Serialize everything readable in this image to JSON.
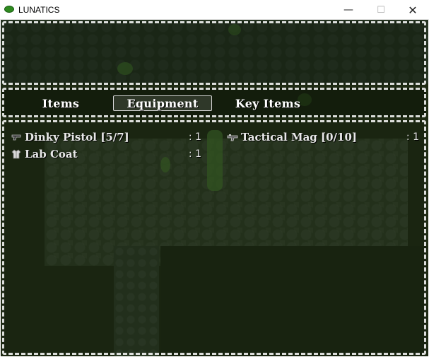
{
  "window": {
    "title": "LUNATICS",
    "minimize_glyph": "—",
    "maximize_glyph": "☐",
    "close_glyph": "✕"
  },
  "menu": {
    "tabs": [
      {
        "label": "Items",
        "selected": false
      },
      {
        "label": "Equipment",
        "selected": true
      },
      {
        "label": "Key Items",
        "selected": false
      }
    ],
    "items": [
      {
        "name": "Dinky Pistol [5/7]",
        "count": ": 1",
        "icon": "pistol-icon"
      },
      {
        "name": "Tactical Mag [0/10]",
        "count": ": 1",
        "icon": "gun-magazine-icon"
      },
      {
        "name": "Lab Coat",
        "count": ": 1",
        "icon": "coat-icon"
      }
    ]
  },
  "colors": {
    "frame": "#ffffff",
    "text": "#e8e8e8",
    "background": "#1f2b14",
    "app_icon": "#2f8a1f"
  }
}
